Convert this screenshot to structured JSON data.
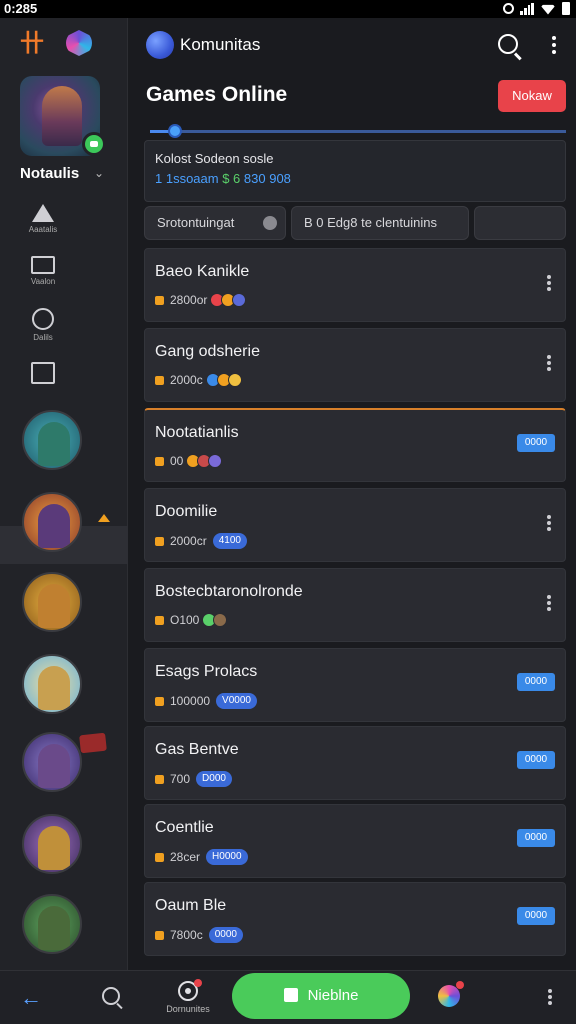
{
  "status": {
    "time": "0:285"
  },
  "app": {
    "title": "Komunitas"
  },
  "sidebar": {
    "profile_name": "Notaulis",
    "nav": [
      {
        "label": "Aaatalis",
        "icon": "triangle-icon"
      },
      {
        "label": "Vaalon",
        "icon": "monitor-icon"
      },
      {
        "label": "Dalils",
        "icon": "controller-icon"
      },
      {
        "label": "",
        "icon": "square-icon"
      }
    ]
  },
  "main": {
    "title": "Games Online",
    "notify_label": "Nokaw",
    "progress": 0.06,
    "info": {
      "title": "Kolost Sodeon sosle",
      "stats_a": "1 1ssoaam",
      "stats_b": "$ 6",
      "stats_c": "830 908"
    },
    "tabs": [
      {
        "label": "Srotontuingat"
      },
      {
        "label": "B 0 Edg8 te clentuinins"
      },
      {
        "label": ""
      }
    ],
    "cards": [
      {
        "title": "Baeo Kanikle",
        "meta": "2800or",
        "action": "more"
      },
      {
        "title": "Gang odsherie",
        "meta": "2000c",
        "action": "more"
      },
      {
        "title": "Nootatianlis",
        "meta": "00",
        "action": "badge",
        "badge": "0000"
      },
      {
        "title": "Doomilie",
        "meta": "2000cr",
        "pill": "4100",
        "action": "more"
      },
      {
        "title": "Bostecbtaronolronde",
        "meta": "O100",
        "action": "more"
      },
      {
        "title": "Esags Prolacs",
        "meta": "100000",
        "pill": "V0000",
        "action": "badge",
        "badge": "0000"
      },
      {
        "title": "Gas Bentve",
        "meta": "700",
        "pill": "D000",
        "action": "badge",
        "badge": "0000"
      },
      {
        "title": "Coentlie",
        "meta": "28cer",
        "pill": "H0000",
        "action": "badge",
        "badge": "0000"
      },
      {
        "title": "Oaum Ble",
        "meta": "7800c",
        "pill": "0000",
        "action": "badge",
        "badge": "0000"
      }
    ]
  },
  "bottom": {
    "community_label": "Dornunites",
    "main_label": "Nieblne"
  },
  "colors": {
    "accent": "#4acb5a",
    "notify": "#e8434a",
    "badge": "#3a8ae8"
  }
}
